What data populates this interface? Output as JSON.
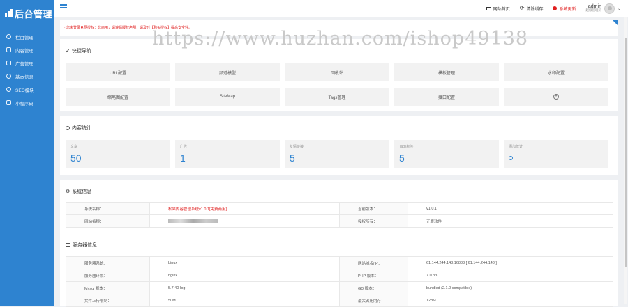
{
  "app": {
    "logo_text": "后台管理"
  },
  "sidebar": {
    "items": [
      {
        "label": "栏目管理",
        "icon": "gear-icon"
      },
      {
        "label": "内容管理",
        "icon": "document-icon"
      },
      {
        "label": "广告管理",
        "icon": "home-icon"
      },
      {
        "label": "基本信息",
        "icon": "settings-icon"
      },
      {
        "label": "SEO模块",
        "icon": "circle-icon"
      },
      {
        "label": "小程序码",
        "icon": "grid-icon"
      }
    ]
  },
  "topbar": {
    "site_home": "网站首页",
    "clear_cache": "清除缓存",
    "system_update": "系统更新",
    "user_name": "admin",
    "user_role": "超级管理员"
  },
  "notice": {
    "text": "· 您未登录官网授权：非商用，请遵循版权声明，请及时【购买授权】提高安全性。"
  },
  "watermark": "https://www.huzhan.com/ishop49138",
  "quicknav": {
    "title": "快捷导航",
    "items": [
      "URL配置",
      "频道模型",
      "回收站",
      "模板管理",
      "水印配置",
      "缩略图配置",
      "SiteMap",
      "Tags管理",
      "接口配置",
      "+"
    ]
  },
  "stats": {
    "title": "内容统计",
    "items": [
      {
        "label": "文章",
        "value": "50"
      },
      {
        "label": "广告",
        "value": "1"
      },
      {
        "label": "友情链接",
        "value": "5"
      },
      {
        "label": "Tags标签",
        "value": "5"
      },
      {
        "label": "添加统计",
        "value": ""
      }
    ]
  },
  "system_info": {
    "title": "系统信息",
    "rows": [
      {
        "k1": "系统名称：",
        "v1": "松果内容管理系统v1.0.1[免费商用]",
        "k2": "当前版本：",
        "v2": "v1.0.1"
      },
      {
        "k1": "网站名称：",
        "v1": "",
        "k2": "授权所有：",
        "v2": "正版软件"
      }
    ]
  },
  "server_info": {
    "title": "服务器信息",
    "rows": [
      {
        "k1": "服务器系统：",
        "v1": "Linux",
        "k2": "网站域名/IP：",
        "v2": "61.144.244.148:16883 [ 61.144.244.148 ]"
      },
      {
        "k1": "服务器环境：",
        "v1": "nginx",
        "k2": "PHP 版本：",
        "v2": "7.0.33"
      },
      {
        "k1": "Mysql 版本：",
        "v1": "5.7.40-log",
        "k2": "GD 版本：",
        "v2": "bundled (2.1.0 compatible)"
      },
      {
        "k1": "文件上传限制：",
        "v1": "50M",
        "k2": "最大占用内存：",
        "v2": "128M"
      }
    ]
  },
  "colors": {
    "accent": "#2e83d0",
    "danger": "#e02020",
    "tile": "#f2f2f2"
  }
}
